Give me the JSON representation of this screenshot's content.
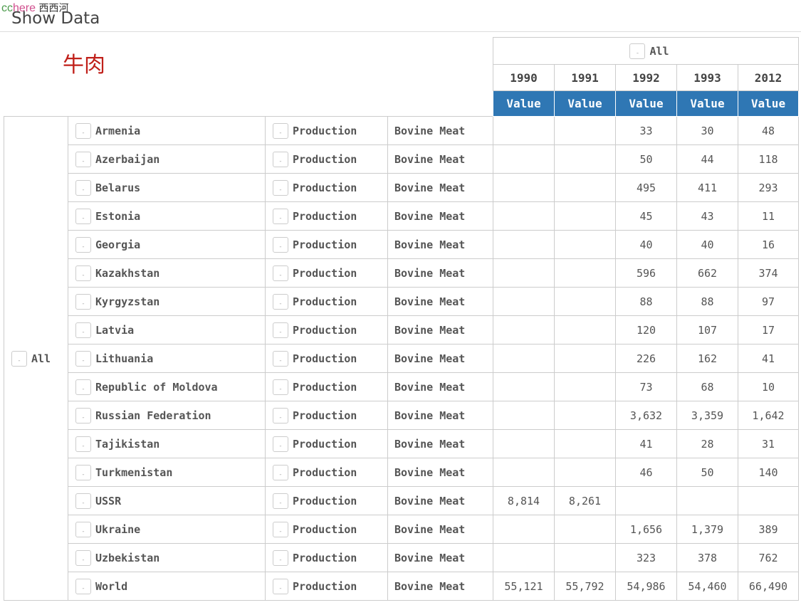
{
  "watermark": {
    "part1": "cc",
    "part2": "here",
    "part3": "西西河"
  },
  "header": {
    "title": "Show Data"
  },
  "annotation": "牛肉",
  "table": {
    "column_group": "All",
    "years": [
      "1990",
      "1991",
      "1992",
      "1993",
      "2012"
    ],
    "measure": "Value",
    "row_group": "All",
    "toggle_glyph": "-",
    "header_color": "#2f77b4",
    "rows": [
      {
        "country": "Armenia",
        "element": "Production",
        "item": "Bovine Meat",
        "values": [
          "",
          "",
          "33",
          "30",
          "48"
        ]
      },
      {
        "country": "Azerbaijan",
        "element": "Production",
        "item": "Bovine Meat",
        "values": [
          "",
          "",
          "50",
          "44",
          "118"
        ]
      },
      {
        "country": "Belarus",
        "element": "Production",
        "item": "Bovine Meat",
        "values": [
          "",
          "",
          "495",
          "411",
          "293"
        ]
      },
      {
        "country": "Estonia",
        "element": "Production",
        "item": "Bovine Meat",
        "values": [
          "",
          "",
          "45",
          "43",
          "11"
        ]
      },
      {
        "country": "Georgia",
        "element": "Production",
        "item": "Bovine Meat",
        "values": [
          "",
          "",
          "40",
          "40",
          "16"
        ]
      },
      {
        "country": "Kazakhstan",
        "element": "Production",
        "item": "Bovine Meat",
        "values": [
          "",
          "",
          "596",
          "662",
          "374"
        ]
      },
      {
        "country": "Kyrgyzstan",
        "element": "Production",
        "item": "Bovine Meat",
        "values": [
          "",
          "",
          "88",
          "88",
          "97"
        ]
      },
      {
        "country": "Latvia",
        "element": "Production",
        "item": "Bovine Meat",
        "values": [
          "",
          "",
          "120",
          "107",
          "17"
        ]
      },
      {
        "country": "Lithuania",
        "element": "Production",
        "item": "Bovine Meat",
        "values": [
          "",
          "",
          "226",
          "162",
          "41"
        ]
      },
      {
        "country": "Republic of Moldova",
        "element": "Production",
        "item": "Bovine Meat",
        "values": [
          "",
          "",
          "73",
          "68",
          "10"
        ]
      },
      {
        "country": "Russian Federation",
        "element": "Production",
        "item": "Bovine Meat",
        "values": [
          "",
          "",
          "3,632",
          "3,359",
          "1,642"
        ]
      },
      {
        "country": "Tajikistan",
        "element": "Production",
        "item": "Bovine Meat",
        "values": [
          "",
          "",
          "41",
          "28",
          "31"
        ]
      },
      {
        "country": "Turkmenistan",
        "element": "Production",
        "item": "Bovine Meat",
        "values": [
          "",
          "",
          "46",
          "50",
          "140"
        ]
      },
      {
        "country": "USSR",
        "element": "Production",
        "item": "Bovine Meat",
        "values": [
          "8,814",
          "8,261",
          "",
          "",
          ""
        ]
      },
      {
        "country": "Ukraine",
        "element": "Production",
        "item": "Bovine Meat",
        "values": [
          "",
          "",
          "1,656",
          "1,379",
          "389"
        ]
      },
      {
        "country": "Uzbekistan",
        "element": "Production",
        "item": "Bovine Meat",
        "values": [
          "",
          "",
          "323",
          "378",
          "762"
        ]
      },
      {
        "country": "World",
        "element": "Production",
        "item": "Bovine Meat",
        "values": [
          "55,121",
          "55,792",
          "54,986",
          "54,460",
          "66,490"
        ]
      }
    ]
  }
}
